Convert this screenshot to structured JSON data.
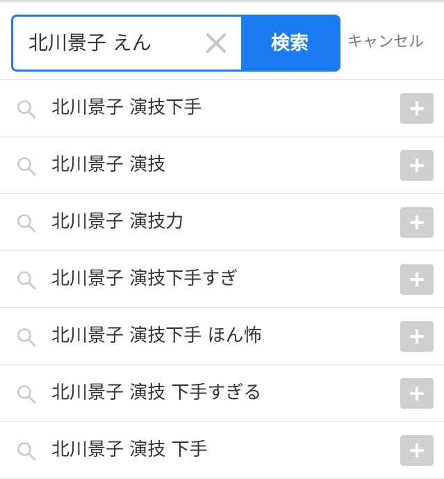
{
  "search": {
    "query": "北川景子 えん",
    "submit_label": "検索",
    "cancel_label": "キャンセル"
  },
  "suggestions": [
    {
      "text": "北川景子 演技下手"
    },
    {
      "text": "北川景子 演技"
    },
    {
      "text": "北川景子 演技力"
    },
    {
      "text": "北川景子 演技下手すぎ"
    },
    {
      "text": "北川景子 演技下手 ほん怖"
    },
    {
      "text": "北川景子 演技 下手すぎる"
    },
    {
      "text": "北川景子 演技 下手"
    }
  ],
  "icons": {
    "clear": "close-icon",
    "suggestion": "search-icon",
    "append": "plus-icon"
  },
  "colors": {
    "accent": "#1a7cf0",
    "add_button": "#cfcfcf",
    "icon_gray": "#c8c8c8"
  }
}
